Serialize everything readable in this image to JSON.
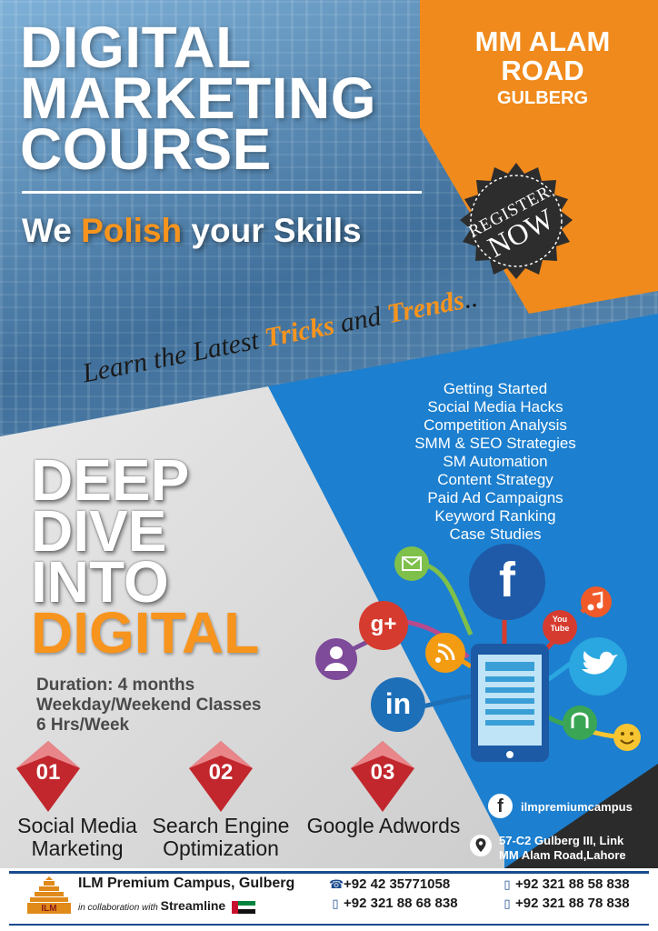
{
  "headline": {
    "lines": [
      "DIGITAL",
      "MARKETING",
      "COURSE"
    ],
    "tagline_pre": "We ",
    "tagline_highlight": "Polish",
    "tagline_post": " your Skills"
  },
  "location": {
    "line1": "MM ALAM",
    "line2": "ROAD",
    "line3": "GULBERG"
  },
  "badge": {
    "line1": "REGISTER",
    "line2": "NOW"
  },
  "learn": {
    "pre": "Learn the Latest ",
    "word1": "Tricks",
    "mid": " and ",
    "word2": "Trends",
    "post": ".."
  },
  "topics": [
    "Getting Started",
    "Social Media Hacks",
    "Competition Analysis",
    "SMM & SEO Strategies",
    "SM Automation",
    "Content Strategy",
    "Paid Ad Campaigns",
    "Keyword Ranking",
    "Case Studies"
  ],
  "deep_dive": {
    "lines": [
      "DEEP",
      "DIVE",
      "INTO"
    ],
    "highlight": "DIGITAL"
  },
  "details": {
    "duration": "Duration: 4 months",
    "classes": "Weekday/Weekend Classes",
    "hours": "6 Hrs/Week"
  },
  "courses": [
    {
      "num": "01",
      "line1": "Social Media",
      "line2": "Marketing"
    },
    {
      "num": "02",
      "line1": "Search Engine",
      "line2": "Optimization"
    },
    {
      "num": "03",
      "line1": "Google Adwords",
      "line2": ""
    }
  ],
  "social_icons": {
    "facebook": "f",
    "gplus": "g+",
    "linkedin": "in",
    "youtube_top": "You",
    "youtube_bottom": "Tube"
  },
  "contact": {
    "facebook_handle": "ilmpremiumcampus",
    "address1": "57-C2 Gulberg III, Link",
    "address2": "MM Alam Road,Lahore"
  },
  "footer": {
    "campus": "ILM Premium Campus, Gulberg",
    "collab": "in collaboration with",
    "brand": "Streamline",
    "logo_text": "ILM",
    "phones": [
      "+92 42 35771058",
      "+92 321 88 68 838",
      "+92 321 88 58 838",
      "+92 321 88 78 838"
    ]
  },
  "colors": {
    "orange": "#f7941d",
    "blue": "#1c7fcf",
    "dark": "#2b2b2b",
    "marker_red": "#c1272d",
    "navy": "#1b4b8e"
  }
}
